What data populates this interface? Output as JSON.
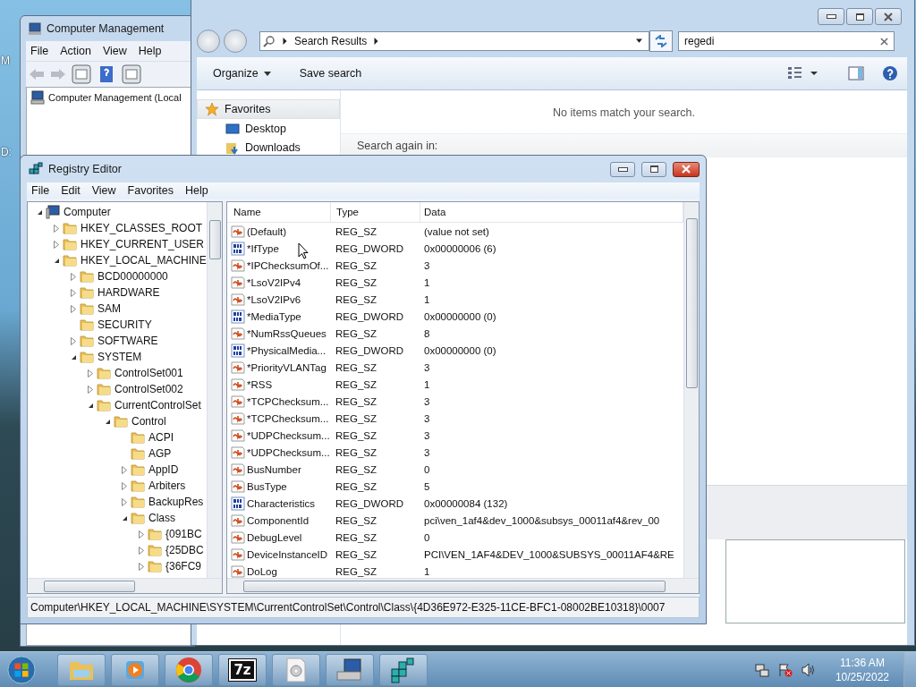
{
  "desktop": {
    "icon_labels": [
      "M",
      "D:"
    ]
  },
  "computer_management": {
    "title": "Computer Management",
    "menu": [
      "File",
      "Action",
      "View",
      "Help"
    ],
    "tree": [
      {
        "label": "Computer Management (Local"
      }
    ]
  },
  "explorer": {
    "address": [
      "Search Results"
    ],
    "search": {
      "value": "regedi"
    },
    "toolbar": [
      {
        "label": "Organize",
        "dropdown": true
      },
      {
        "label": "Save search",
        "dropdown": false
      }
    ],
    "nav": {
      "label": "Favorites",
      "items": [
        {
          "label": "Desktop",
          "kind": "desktop"
        },
        {
          "label": "Downloads",
          "kind": "downloads"
        }
      ]
    },
    "message": "No items match your search.",
    "search_again": "Search again in:"
  },
  "registry_editor": {
    "title": "Registry Editor",
    "menu": [
      "File",
      "Edit",
      "View",
      "Favorites",
      "Help"
    ],
    "tree": [
      {
        "label": "Computer",
        "kind": "computer",
        "expandable": true,
        "expanded": true,
        "children": [
          {
            "label": "HKEY_CLASSES_ROOT",
            "kind": "folder",
            "expandable": true,
            "expanded": false
          },
          {
            "label": "HKEY_CURRENT_USER",
            "kind": "folder",
            "expandable": true,
            "expanded": false
          },
          {
            "label": "HKEY_LOCAL_MACHINE",
            "kind": "folder",
            "expandable": true,
            "expanded": true,
            "children": [
              {
                "label": "BCD00000000",
                "kind": "folder",
                "expandable": true,
                "expanded": false
              },
              {
                "label": "HARDWARE",
                "kind": "folder",
                "expandable": true,
                "expanded": false
              },
              {
                "label": "SAM",
                "kind": "folder",
                "expandable": true,
                "expanded": false
              },
              {
                "label": "SECURITY",
                "kind": "folder",
                "expandable": false,
                "expanded": false
              },
              {
                "label": "SOFTWARE",
                "kind": "folder",
                "expandable": true,
                "expanded": false
              },
              {
                "label": "SYSTEM",
                "kind": "folder",
                "expandable": true,
                "expanded": true,
                "children": [
                  {
                    "label": "ControlSet001",
                    "kind": "folder",
                    "expandable": true,
                    "expanded": false
                  },
                  {
                    "label": "ControlSet002",
                    "kind": "folder",
                    "expandable": true,
                    "expanded": false
                  },
                  {
                    "label": "CurrentControlSet",
                    "kind": "folder",
                    "expandable": true,
                    "expanded": true,
                    "children": [
                      {
                        "label": "Control",
                        "kind": "folder",
                        "expandable": true,
                        "expanded": true,
                        "children": [
                          {
                            "label": "ACPI",
                            "kind": "folder",
                            "expandable": false,
                            "expanded": false
                          },
                          {
                            "label": "AGP",
                            "kind": "folder",
                            "expandable": false,
                            "expanded": false
                          },
                          {
                            "label": "AppID",
                            "kind": "folder",
                            "expandable": true,
                            "expanded": false
                          },
                          {
                            "label": "Arbiters",
                            "kind": "folder",
                            "expandable": true,
                            "expanded": false
                          },
                          {
                            "label": "BackupRes",
                            "kind": "folder",
                            "expandable": true,
                            "expanded": false
                          },
                          {
                            "label": "Class",
                            "kind": "folder",
                            "expandable": true,
                            "expanded": true,
                            "children": [
                              {
                                "label": "{091BC",
                                "kind": "folder",
                                "expandable": true,
                                "expanded": false
                              },
                              {
                                "label": "{25DBC",
                                "kind": "folder",
                                "expandable": true,
                                "expanded": false
                              },
                              {
                                "label": "{36FC9",
                                "kind": "folder",
                                "expandable": true,
                                "expanded": false
                              }
                            ]
                          }
                        ]
                      }
                    ]
                  }
                ]
              }
            ]
          }
        ]
      }
    ],
    "columns": [
      "Name",
      "Type",
      "Data"
    ],
    "rows": [
      {
        "kind": "sz",
        "name": "(Default)",
        "type": "REG_SZ",
        "data": "(value not set)"
      },
      {
        "kind": "dword",
        "name": "*IfType",
        "type": "REG_DWORD",
        "data": "0x00000006 (6)"
      },
      {
        "kind": "sz",
        "name": "*IPChecksumOf...",
        "type": "REG_SZ",
        "data": "3"
      },
      {
        "kind": "sz",
        "name": "*LsoV2IPv4",
        "type": "REG_SZ",
        "data": "1"
      },
      {
        "kind": "sz",
        "name": "*LsoV2IPv6",
        "type": "REG_SZ",
        "data": "1"
      },
      {
        "kind": "dword",
        "name": "*MediaType",
        "type": "REG_DWORD",
        "data": "0x00000000 (0)"
      },
      {
        "kind": "sz",
        "name": "*NumRssQueues",
        "type": "REG_SZ",
        "data": "8"
      },
      {
        "kind": "dword",
        "name": "*PhysicalMedia...",
        "type": "REG_DWORD",
        "data": "0x00000000 (0)"
      },
      {
        "kind": "sz",
        "name": "*PriorityVLANTag",
        "type": "REG_SZ",
        "data": "3"
      },
      {
        "kind": "sz",
        "name": "*RSS",
        "type": "REG_SZ",
        "data": "1"
      },
      {
        "kind": "sz",
        "name": "*TCPChecksum...",
        "type": "REG_SZ",
        "data": "3"
      },
      {
        "kind": "sz",
        "name": "*TCPChecksum...",
        "type": "REG_SZ",
        "data": "3"
      },
      {
        "kind": "sz",
        "name": "*UDPChecksum...",
        "type": "REG_SZ",
        "data": "3"
      },
      {
        "kind": "sz",
        "name": "*UDPChecksum...",
        "type": "REG_SZ",
        "data": "3"
      },
      {
        "kind": "sz",
        "name": "BusNumber",
        "type": "REG_SZ",
        "data": "0"
      },
      {
        "kind": "sz",
        "name": "BusType",
        "type": "REG_SZ",
        "data": "5"
      },
      {
        "kind": "dword",
        "name": "Characteristics",
        "type": "REG_DWORD",
        "data": "0x00000084 (132)"
      },
      {
        "kind": "sz",
        "name": "ComponentId",
        "type": "REG_SZ",
        "data": "pci\\ven_1af4&dev_1000&subsys_00011af4&rev_00"
      },
      {
        "kind": "sz",
        "name": "DebugLevel",
        "type": "REG_SZ",
        "data": "0"
      },
      {
        "kind": "sz",
        "name": "DeviceInstanceID",
        "type": "REG_SZ",
        "data": "PCI\\VEN_1AF4&DEV_1000&SUBSYS_00011AF4&RE"
      },
      {
        "kind": "sz",
        "name": "DoLog",
        "type": "REG_SZ",
        "data": "1"
      }
    ],
    "status_bar": "Computer\\HKEY_LOCAL_MACHINE\\SYSTEM\\CurrentControlSet\\Control\\Class\\{4D36E972-E325-11CE-BFC1-08002BE10318}\\0007"
  },
  "taskbar": {
    "items": [
      {
        "kind": "explorer"
      },
      {
        "kind": "media"
      },
      {
        "kind": "browser"
      },
      {
        "kind": "archiver",
        "label": "7z"
      },
      {
        "kind": "disc"
      },
      {
        "kind": "computer"
      },
      {
        "kind": "registry"
      }
    ],
    "clock": {
      "time": "11:36 AM",
      "date": "10/25/2022"
    }
  }
}
